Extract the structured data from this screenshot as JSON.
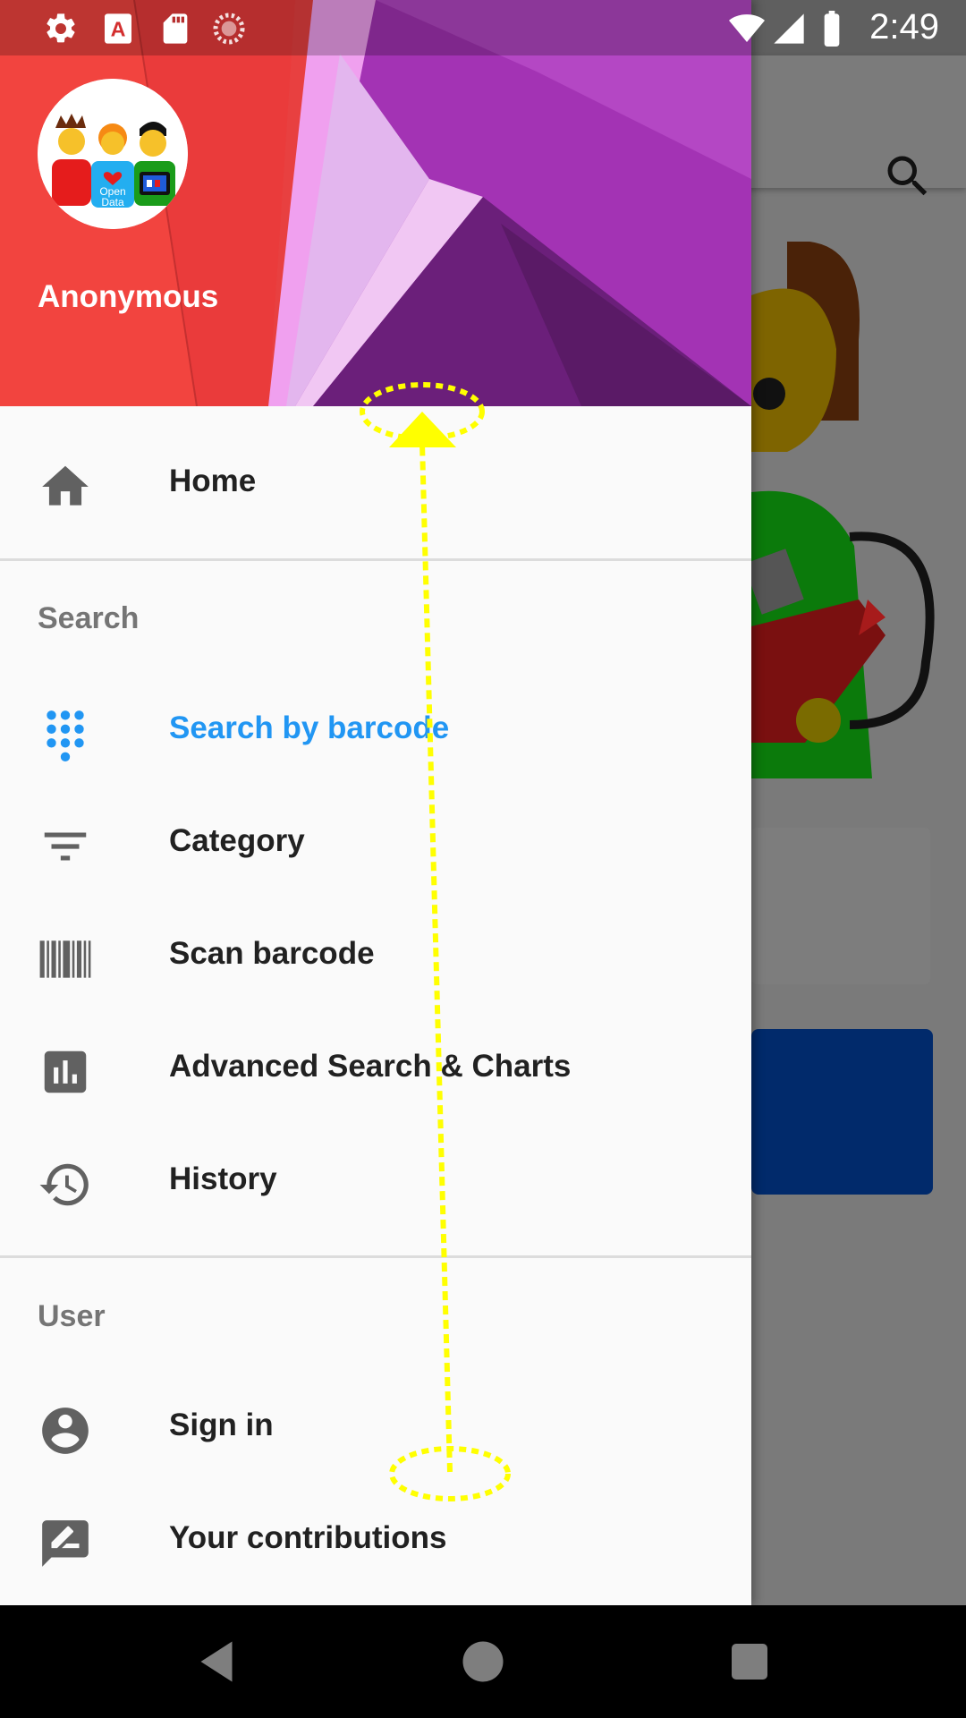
{
  "status_bar": {
    "time": "2:49",
    "left_icons": [
      "settings-icon",
      "font-a-icon",
      "sd-card-icon",
      "loading-icon"
    ],
    "right_icons": [
      "wifi-icon",
      "cell-signal-icon",
      "battery-icon"
    ]
  },
  "drawer": {
    "header": {
      "user_name": "Anonymous",
      "avatar_text": [
        "Open",
        "Data"
      ],
      "colors": {
        "red": "#f2443f",
        "purple": "#9c2fb0"
      }
    },
    "primary": {
      "label": "Home",
      "icon": "home-icon"
    },
    "search_section": {
      "title": "Search",
      "items": [
        {
          "label": "Search by barcode",
          "icon": "dialpad-icon",
          "active": true
        },
        {
          "label": "Category",
          "icon": "filter-icon",
          "active": false
        },
        {
          "label": "Scan barcode",
          "icon": "barcode-icon",
          "active": false
        },
        {
          "label": "Advanced Search & Charts",
          "icon": "bar-chart-icon",
          "active": false
        },
        {
          "label": "History",
          "icon": "history-icon",
          "active": false
        }
      ]
    },
    "user_section": {
      "title": "User",
      "items": [
        {
          "label": "Sign in",
          "icon": "account-circle-icon"
        },
        {
          "label": "Your contributions",
          "icon": "rate-review-icon"
        }
      ]
    },
    "active_color": "#2196f3"
  },
  "background_app": {
    "toolbar_icon": "search-icon",
    "button_color": "#012a6b"
  },
  "gesture": {
    "type": "swipe-up",
    "color": "#ffff00"
  },
  "nav_bar": {
    "buttons": [
      "back-icon",
      "home-circle-icon",
      "recents-icon"
    ]
  }
}
